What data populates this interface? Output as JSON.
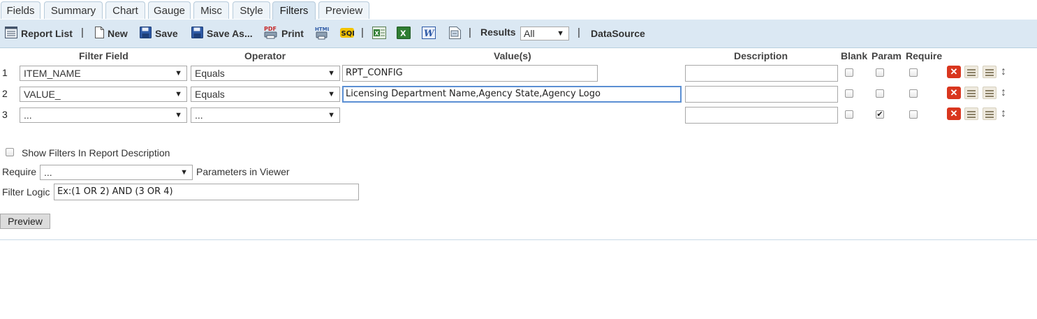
{
  "tabs": [
    "Fields",
    "Summary",
    "Chart",
    "Gauge",
    "Misc",
    "Style",
    "Filters",
    "Preview"
  ],
  "active_tab": "Filters",
  "toolbar": {
    "report_list": "Report List",
    "sep": "|",
    "new": "New",
    "save": "Save",
    "save_as": "Save As...",
    "print": "Print",
    "results_label": "Results",
    "results_value": "All",
    "datasource": "DataSource"
  },
  "grid": {
    "headers": {
      "filter_field": "Filter Field",
      "operator": "Operator",
      "values": "Value(s)",
      "description": "Description",
      "blank": "Blank",
      "param": "Param",
      "require": "Require"
    },
    "rows": [
      {
        "num": "1",
        "field": "ITEM_NAME",
        "operator": "Equals",
        "value": "RPT_CONFIG",
        "description": "",
        "blank": false,
        "param": false,
        "require": false
      },
      {
        "num": "2",
        "field": "VALUE_",
        "operator": "Equals",
        "value": "Licensing Department Name,Agency State,Agency Logo",
        "description": "",
        "blank": false,
        "param": false,
        "require": false
      },
      {
        "num": "3",
        "field": "...",
        "operator": "...",
        "value": "",
        "description": "",
        "blank": false,
        "param": true,
        "require": false
      }
    ]
  },
  "options": {
    "show_filters_label": "Show Filters In Report Description",
    "require_label": "Require",
    "require_value": "...",
    "params_in_viewer": "Parameters in Viewer",
    "filter_logic_label": "Filter Logic",
    "filter_logic_placeholder": "Ex:(1 OR 2) AND (3 OR 4)"
  },
  "preview_button": "Preview",
  "icons": {
    "report_list": "list-icon",
    "new": "page-icon",
    "save": "floppy-icon",
    "print": "printer-icon",
    "html": "html-icon",
    "sql": "sql-icon",
    "excel_a": "excel-icon",
    "excel_b": "excel-icon",
    "word": "word-icon",
    "export": "export-icon",
    "delete": "delete-icon",
    "move_up": "move-up-icon",
    "move_down": "move-down-icon",
    "drag": "drag-icon"
  }
}
